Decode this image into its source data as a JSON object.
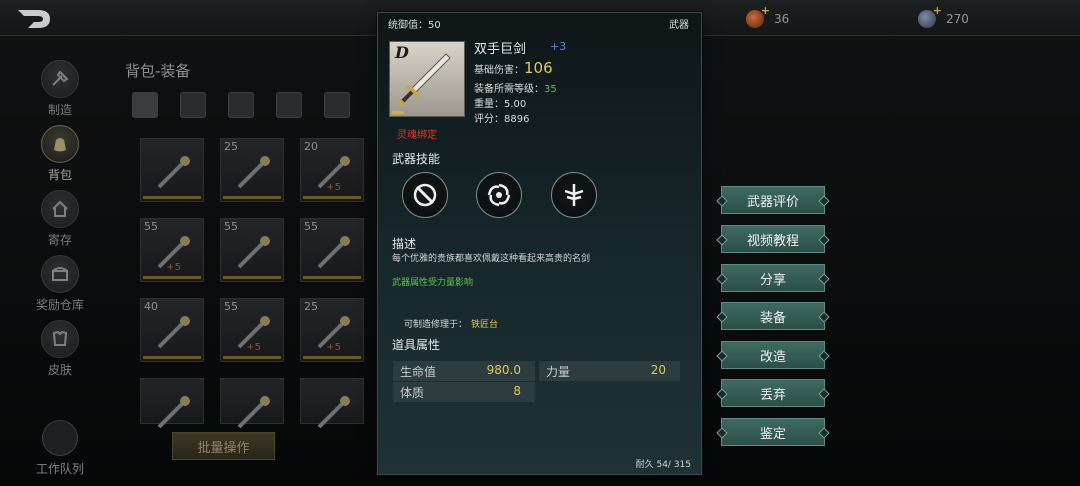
{
  "topbar": {
    "copper_amount": "36",
    "gem_amount": "270"
  },
  "sidenav": {
    "items": [
      {
        "label": "制造",
        "icon": "hammer-icon"
      },
      {
        "label": "背包",
        "icon": "bag-icon"
      },
      {
        "label": "寄存",
        "icon": "storage-icon"
      },
      {
        "label": "奖励仓库",
        "icon": "reward-chest-icon"
      },
      {
        "label": "皮肤",
        "icon": "armor-icon"
      }
    ],
    "active": "背包"
  },
  "bag": {
    "title": "背包-装备",
    "tabs": [
      "grid-icon",
      "pouch-icon",
      "ball-icon",
      "potion-icon",
      "building-icon"
    ],
    "slots": [
      {
        "level": "",
        "icon": "staff-icon",
        "bonus": ""
      },
      {
        "level": "25",
        "icon": "axe-icon",
        "bonus": ""
      },
      {
        "level": "20",
        "icon": "spear-icon",
        "bonus": "+5"
      },
      {
        "level": "55",
        "icon": "mace-icon",
        "bonus": "+5"
      },
      {
        "level": "55",
        "icon": "wand-icon",
        "bonus": ""
      },
      {
        "level": "55",
        "icon": "staff-icon",
        "bonus": ""
      },
      {
        "level": "40",
        "icon": "web-icon",
        "bonus": ""
      },
      {
        "level": "55",
        "icon": "mace-icon",
        "bonus": "+5"
      },
      {
        "level": "25",
        "icon": "staff-icon",
        "bonus": "+5"
      },
      {
        "level": "",
        "icon": "armor-icon",
        "bonus": ""
      },
      {
        "level": "",
        "icon": "armor-icon",
        "bonus": ""
      },
      {
        "level": "",
        "icon": "armor-icon",
        "bonus": ""
      }
    ],
    "batch_label": "批量操作"
  },
  "worklist_label": "工作队列",
  "item": {
    "command_label": "统御值：",
    "command_value": "50",
    "category": "武器",
    "grade": "D",
    "bound": "灵魂绑定",
    "name": "双手巨剑",
    "enhance": "+3",
    "base_damage_label": "基础伤害：",
    "base_damage": "106",
    "req_level_label": "装备所需等级：",
    "req_level": "35",
    "weight_label": "重量：",
    "weight": "5.00",
    "score_label": "评分：",
    "score": "8896",
    "skills_title": "武器技能",
    "skills": [
      "skill-slash-icon",
      "skill-vortex-icon",
      "skill-shield-icon"
    ],
    "desc_title": "描述",
    "desc": "每个优雅的贵族都喜欢佩戴这种看起来高贵的名剑",
    "strength_note": "武器属性受力量影响",
    "repair_label": "可制造修理于：",
    "repair_place": "铁匠台",
    "attrs_title": "道具属性",
    "attrs": [
      {
        "k": "生命值",
        "v": "980.0"
      },
      {
        "k": "力量",
        "v": "20"
      },
      {
        "k": "体质",
        "v": "8"
      }
    ],
    "durability_label": "耐久",
    "durability": "54/ 315"
  },
  "actions": [
    "武器评价",
    "视频教程",
    "分享",
    "装备",
    "改造",
    "丢弃",
    "鉴定"
  ],
  "colors": {
    "accent_gold": "#e0c85a",
    "bound_red": "#e03a2a",
    "green": "#4bc34f",
    "action_teal": "#3f6a63"
  }
}
